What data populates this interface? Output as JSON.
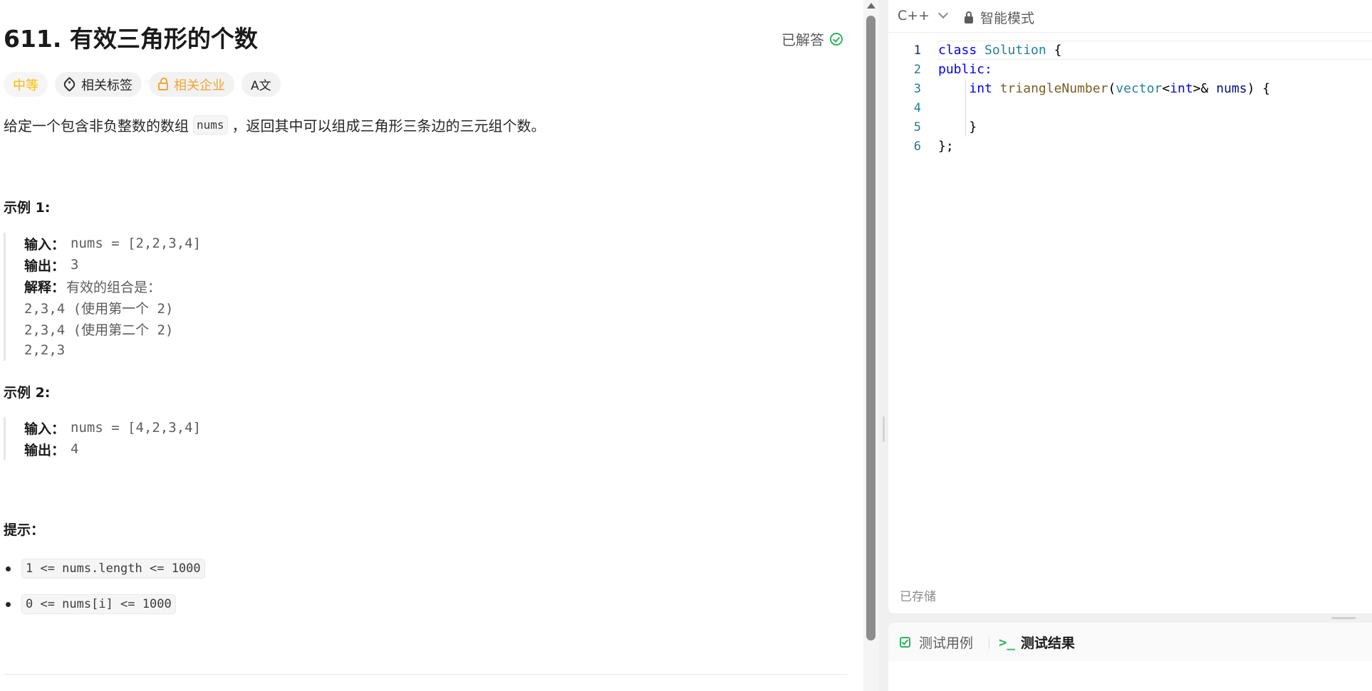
{
  "problem": {
    "title": "611. 有效三角形的个数",
    "status": "已解答",
    "tags": {
      "difficulty": "中等",
      "related_tags": "相关标签",
      "related_companies": "相关企业",
      "translate": "A文"
    },
    "description": {
      "before": "给定一个包含非负整数的数组",
      "code": "nums",
      "after": "，返回其中可以组成三角形三条边的三元组个数。"
    },
    "examples": [
      {
        "heading": "示例 1:",
        "input_label": "输入：",
        "input_value": "nums = [2,2,3,4]",
        "output_label": "输出：",
        "output_value": "3",
        "explain_label": "解释：",
        "explain_text": "有效的组合是：",
        "explain_lines": [
          "2,3,4 (使用第一个 2)",
          "2,3,4 (使用第二个 2)",
          "2,2,3"
        ]
      },
      {
        "heading": "示例 2:",
        "input_label": "输入：",
        "input_value": "nums = [4,2,3,4]",
        "output_label": "输出：",
        "output_value": "4"
      }
    ],
    "hints_heading": "提示：",
    "constraints": [
      "1 <= nums.length <= 1000",
      "0 <= nums[i] <= 1000"
    ]
  },
  "editor": {
    "language": "C++",
    "mode": "智能模式",
    "line_numbers": [
      "1",
      "2",
      "3",
      "4",
      "5",
      "6"
    ],
    "code": {
      "l1_kw": "class",
      "l1_type": "Solution",
      "l1_rest": " {",
      "l2_kw": "public:",
      "l3_kw": "int",
      "l3_fn": "triangleNumber",
      "l3_p1": "(",
      "l3_type": "vector",
      "l3_lt": "<",
      "l3_int": "int",
      "l3_gt": ">",
      "l3_amp": "& ",
      "l3_var": "nums",
      "l3_rest": ") {",
      "l5": "}",
      "l6": "};"
    },
    "saved_status": "已存储"
  },
  "bottom_panel": {
    "tab_testcase": "测试用例",
    "tab_result_icon": ">_",
    "tab_result": "测试结果"
  },
  "colors": {
    "difficulty": "#ffb800",
    "company": "#f2a53a",
    "success": "#2db55d"
  }
}
